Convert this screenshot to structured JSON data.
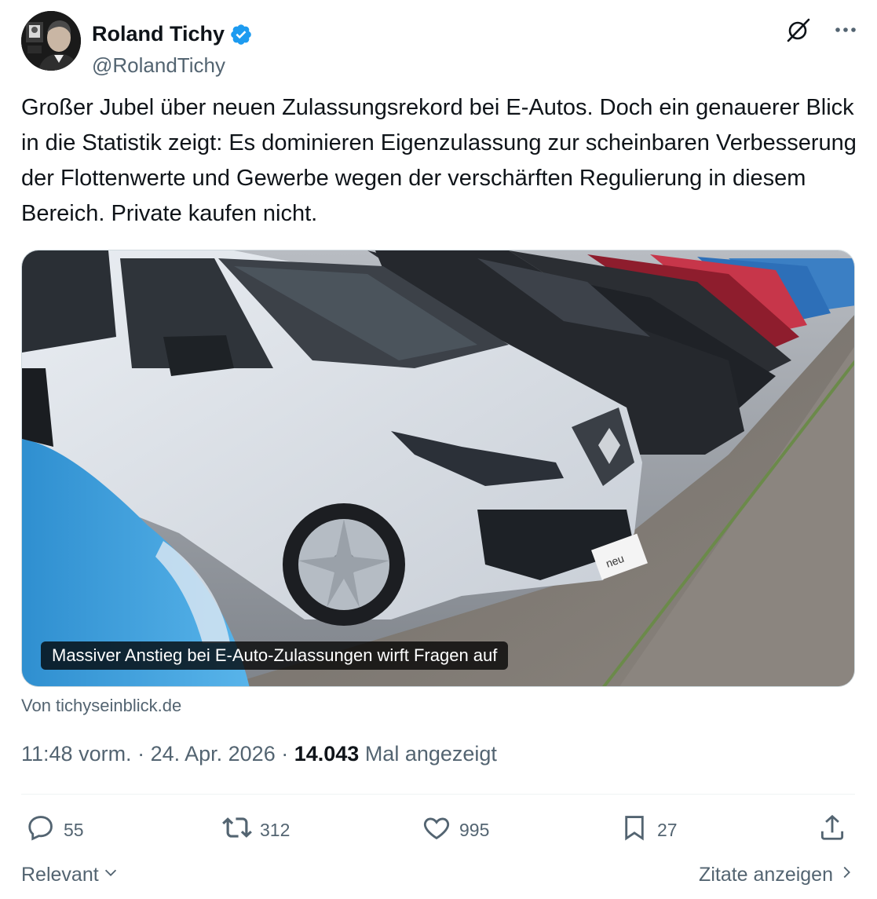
{
  "author": {
    "display_name": "Roland Tichy",
    "handle": "@RolandTichy"
  },
  "tweet": {
    "text": "Großer Jubel über neuen Zulassungsrekord bei E-Autos. Doch ein genauerer Blick in die Statistik zeigt: Es dominieren Eigenzulassung zur scheinbaren Verbesserung der Flottenwerte und Gewerbe wegen der verschärften Regulierung in diesem Bereich. Private kaufen nicht."
  },
  "card": {
    "caption": "Massiver Anstieg bei E-Auto-Zulassungen wirft Fragen auf",
    "source": "Von tichyseinblick.de",
    "plate_text": "neu"
  },
  "meta": {
    "time": "11:48 vorm.",
    "sep1": " · ",
    "date": "24. Apr. 2026",
    "sep2": " · ",
    "views_count": "14.043",
    "views_label": " Mal angezeigt"
  },
  "actions": {
    "replies": "55",
    "reposts": "312",
    "likes": "995",
    "bookmarks": "27"
  },
  "footer": {
    "sort_label": "Relevant",
    "quotes_label": "Zitate anzeigen"
  },
  "icons": {
    "verified": "verified-badge-icon",
    "grok": "grok-icon",
    "more": "more-icon",
    "reply": "reply-icon",
    "repost": "repost-icon",
    "like": "heart-icon",
    "bookmark": "bookmark-icon",
    "share": "share-icon",
    "chevron_down": "chevron-down-icon",
    "chevron_right": "chevron-right-icon"
  },
  "colors": {
    "verified_blue": "#1d9bf0",
    "text_primary": "#0f1419",
    "text_secondary": "#536471"
  }
}
